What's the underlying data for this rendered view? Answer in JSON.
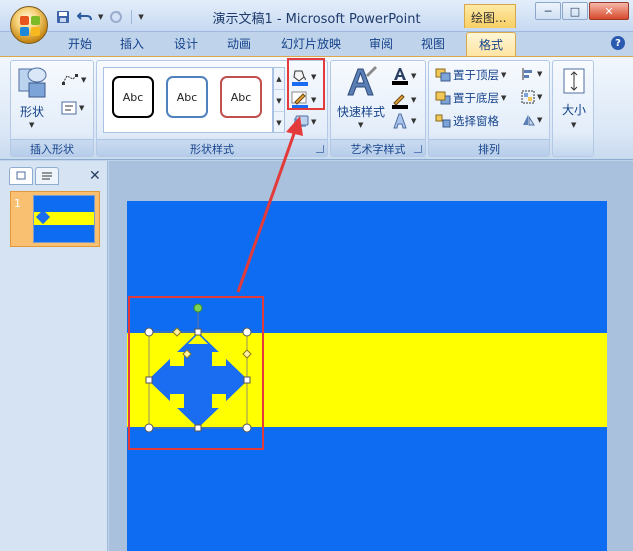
{
  "window": {
    "title": "演示文稿1 - Microsoft PowerPoint",
    "context_tab_title": "绘图...",
    "minimize": "─",
    "maximize": "□",
    "close": "✕"
  },
  "quick_access": {
    "save_icon": "save-icon",
    "undo_icon": "undo-icon",
    "redo_icon": "redo-icon",
    "customize_icon": "dropdown-icon"
  },
  "tabs": [
    "开始",
    "插入",
    "设计",
    "动画",
    "幻灯片放映",
    "审阅",
    "视图",
    "格式"
  ],
  "active_tab": "格式",
  "ribbon": {
    "insert_shapes": {
      "label": "插入形状",
      "shapes_button": "形状"
    },
    "shape_styles": {
      "label": "形状样式",
      "samples": [
        "Abc",
        "Abc",
        "Abc"
      ],
      "sample_colors": [
        "#000000",
        "#4f81bd",
        "#c0504d"
      ],
      "fill_color": "#1a6cf0",
      "outline_color": "#1a6cf0"
    },
    "wordart": {
      "label": "艺术字样式",
      "quick_styles": "快速样式"
    },
    "arrange": {
      "label": "排列",
      "bring_front": "置于顶层",
      "send_back": "置于底层",
      "selection_pane": "选择窗格"
    },
    "size": {
      "label": "大小"
    }
  },
  "slides_panel": {
    "slide_number": "1"
  },
  "slide": {
    "background_color": "#0d6cf2",
    "band_color": "#ffff00",
    "shape_color": "#1a6cf0"
  },
  "annotation_color": "#e33b3b"
}
